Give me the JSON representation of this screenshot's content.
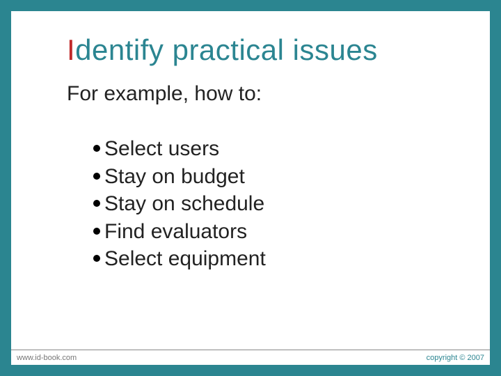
{
  "title": {
    "first_letter": "I",
    "rest": "dentify practical issues"
  },
  "subtitle": "For example, how to:",
  "bullets": [
    "Select users",
    "Stay on budget",
    "Stay on schedule",
    "Find evaluators",
    "Select equipment"
  ],
  "footer": {
    "left": "www.id-book.com",
    "right": "copyright © 2007"
  }
}
